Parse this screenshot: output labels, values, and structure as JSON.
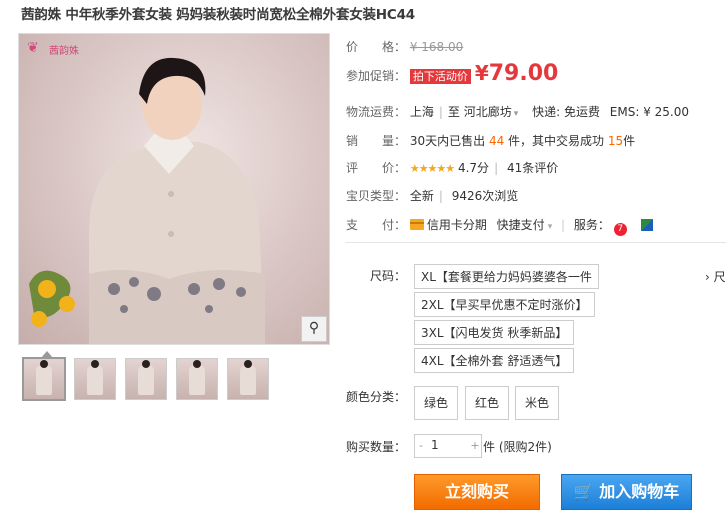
{
  "title": "茜韵姝 中年秋季外套女装 妈妈装秋装时尚宽松全棉外套女装HC44",
  "logo": {
    "mark": "❦",
    "text": "茜韵姝"
  },
  "price": {
    "label": "价　　格：",
    "value": "¥ 168.00"
  },
  "promo": {
    "label": "参加促销：",
    "badge": "拍下活动价",
    "currency": "¥",
    "value": "79.00"
  },
  "shipping": {
    "label": "物流运费：",
    "from": "上海",
    "sep": "至",
    "to": "河北廊坊",
    "express": "快递: 免运费",
    "ems": "EMS: ¥ 25.00"
  },
  "sales": {
    "label": "销　　量：",
    "prefix": "30天内已售出",
    "count": "44",
    "mid": "件，其中交易成功",
    "success": "15",
    "suffix": "件"
  },
  "rating": {
    "label": "评　　价：",
    "stars": "★★★★★",
    "score": "4.7分",
    "reviews": "41条评价"
  },
  "type": {
    "label": "宝贝类型：",
    "condition": "全新",
    "views": "9426次浏览"
  },
  "payment": {
    "label": "支　　付：",
    "credit": "信用卡分期",
    "quick": "快捷支付",
    "service_label": "服务：",
    "service_icon_text": "7"
  },
  "size": {
    "label": "尺码：",
    "options": [
      "XL【套餐更给力妈妈婆婆各一件",
      "2XL【早买早优惠不定时涨价】",
      "3XL【闪电发货 秋季新品】",
      "4XL【全棉外套 舒适透气】"
    ],
    "more": "› 尺码"
  },
  "color": {
    "label": "颜色分类：",
    "options": [
      "绿色",
      "红色",
      "米色"
    ]
  },
  "quantity": {
    "label": "购买数量：",
    "minus": "-",
    "value": "1",
    "plus": "+",
    "unit": "件",
    "limit": "(限购2件)"
  },
  "buttons": {
    "buy": "立刻购买",
    "cart": "加入购物车"
  },
  "colors": {
    "accent_red": "#e4393c",
    "orange": "#f60",
    "buy_bg": "#f26b00",
    "cart_bg": "#1c7fd8"
  }
}
